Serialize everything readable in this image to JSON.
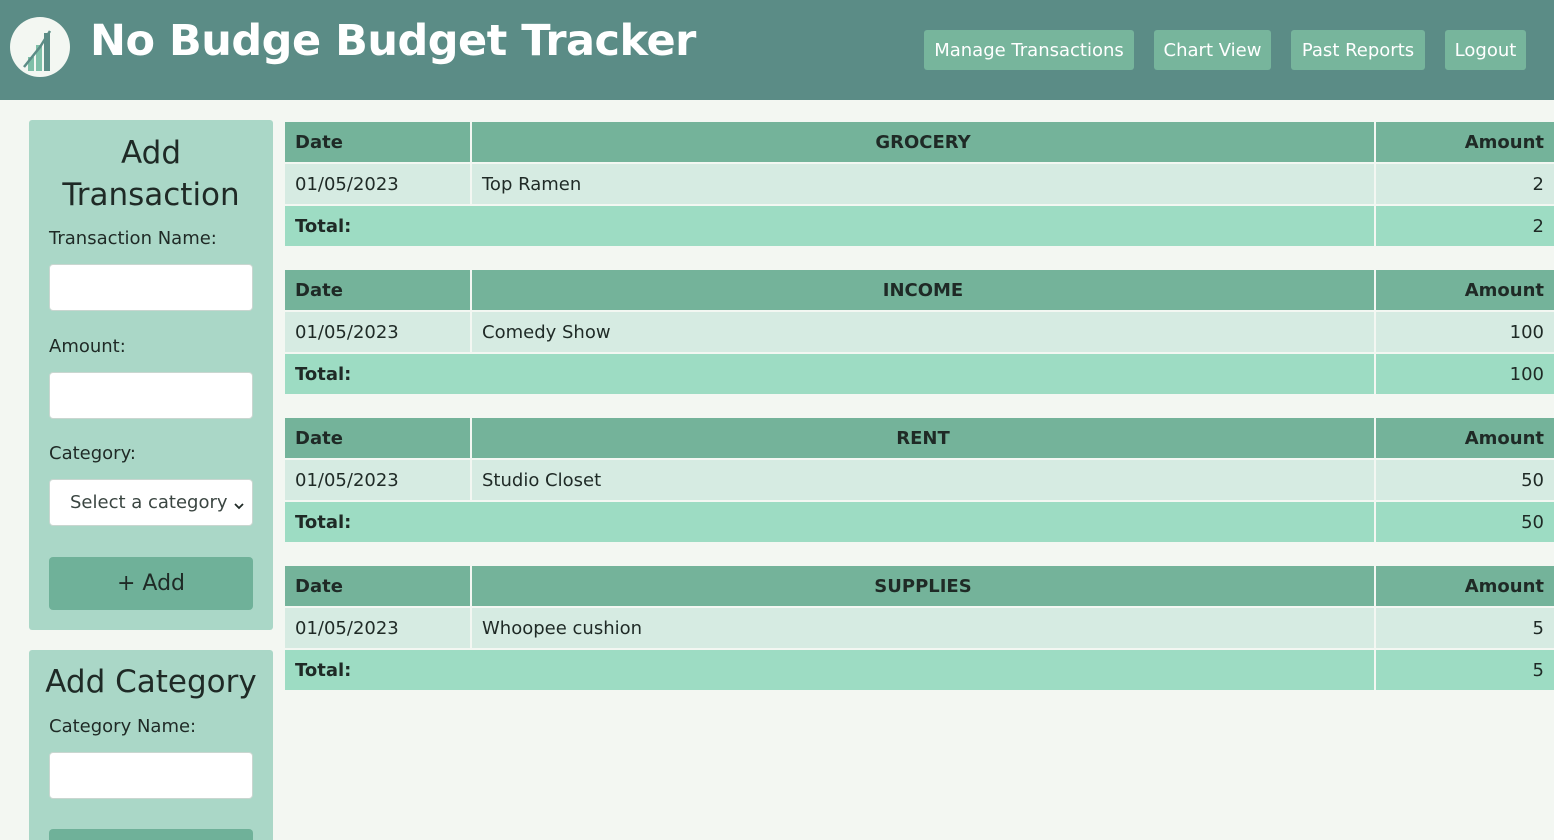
{
  "app": {
    "title": "No Budge Budget Tracker"
  },
  "nav": [
    {
      "label": "Manage Transactions"
    },
    {
      "label": "Chart View"
    },
    {
      "label": "Past Reports"
    },
    {
      "label": "Logout"
    }
  ],
  "add_transaction": {
    "title_line1": "Add",
    "title_line2": "Transaction",
    "name_label": "Transaction Name:",
    "name_value": "",
    "amount_label": "Amount:",
    "amount_value": "",
    "category_label": "Category:",
    "category_selected": "Select a category",
    "add_button": "+ Add"
  },
  "add_category": {
    "title": "Add Category",
    "name_label": "Category Name:",
    "name_value": ""
  },
  "tables": [
    {
      "category": "GROCERY",
      "header_date": "Date",
      "header_amount": "Amount",
      "rows": [
        {
          "date": "01/05/2023",
          "name": "Top Ramen",
          "amount": "2"
        }
      ],
      "total_label": "Total:",
      "total": "2"
    },
    {
      "category": "INCOME",
      "header_date": "Date",
      "header_amount": "Amount",
      "rows": [
        {
          "date": "01/05/2023",
          "name": "Comedy Show",
          "amount": "100"
        }
      ],
      "total_label": "Total:",
      "total": "100"
    },
    {
      "category": "RENT",
      "header_date": "Date",
      "header_amount": "Amount",
      "rows": [
        {
          "date": "01/05/2023",
          "name": "Studio Closet",
          "amount": "50"
        }
      ],
      "total_label": "Total:",
      "total": "50"
    },
    {
      "category": "SUPPLIES",
      "header_date": "Date",
      "header_amount": "Amount",
      "rows": [
        {
          "date": "01/05/2023",
          "name": "Whoopee cushion",
          "amount": "5"
        }
      ],
      "total_label": "Total:",
      "total": "5"
    }
  ],
  "colors": {
    "header_bg": "#5b8c86",
    "nav_button": "#77b59c",
    "panel_bg": "#aad7c7",
    "table_header": "#74b39a",
    "table_row": "#d6ebe2",
    "table_total": "#9ddcc3"
  },
  "icons": {
    "logo": "chart-bars-logo-icon",
    "select": "chevron-down-icon"
  }
}
